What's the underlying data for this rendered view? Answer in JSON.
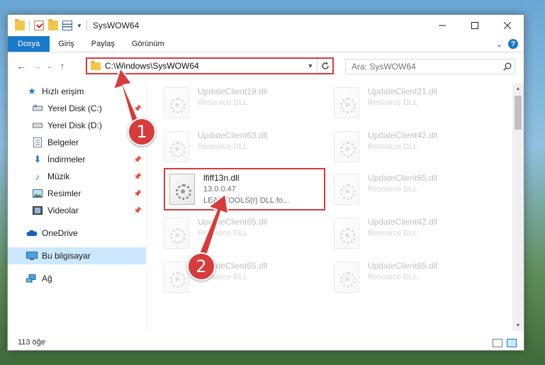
{
  "window": {
    "title": "SysWOW64"
  },
  "ribbon": {
    "tabs": [
      "Dosya",
      "Giriş",
      "Paylaş",
      "Görünüm"
    ]
  },
  "address": {
    "path": "C:\\Windows\\SysWOW64"
  },
  "search": {
    "placeholder": "Ara: SysWOW64"
  },
  "sidebar": {
    "quick_access": "Hızlı erişim",
    "items": [
      {
        "label": "Yerel Disk (C:)",
        "pinned": true
      },
      {
        "label": "Yerel Disk (D:)",
        "pinned": true
      },
      {
        "label": "Belgeler",
        "pinned": true
      },
      {
        "label": "İndirmeler",
        "pinned": true
      },
      {
        "label": "Müzik",
        "pinned": true
      },
      {
        "label": "Resimler",
        "pinned": true
      },
      {
        "label": "Videolar",
        "pinned": true
      }
    ],
    "onedrive": "OneDrive",
    "this_pc": "Bu bilgisayar",
    "network": "Ağ"
  },
  "files": [
    {
      "name": "UpdateClient19.dll",
      "line2": "Resource DLL",
      "faded": true
    },
    {
      "name": "UpdateClient21.dll",
      "line2": "Resource DLL",
      "faded": true
    },
    {
      "name": "UpdateClient63.dll",
      "line2": "Resource DLL",
      "faded": true
    },
    {
      "name": "UpdateClient42.dll",
      "line2": "Resource DLL",
      "faded": true
    },
    {
      "name": "lfiff13n.dll",
      "line2": "13.0.0.47",
      "line3": "LEADTOOLS(r) DLL fo...",
      "faded": false
    },
    {
      "name": "UpdateClient65.dll",
      "line2": "Resource DLL",
      "faded": true
    },
    {
      "name": "UpdateClient65.dll",
      "line2": "Resource DLL",
      "faded": true
    },
    {
      "name": "UpdateClient42.dll",
      "line2": "Resource DLL",
      "faded": true
    },
    {
      "name": "UpdateClient65.dll",
      "line2": "Resource DLL",
      "faded": true
    },
    {
      "name": "UpdateClient65.dll",
      "line2": "Resource DLL",
      "faded": true
    }
  ],
  "status": {
    "count": "113 öğe"
  },
  "annotations": {
    "step1": "1",
    "step2": "2",
    "accent": "#d83b3b"
  }
}
